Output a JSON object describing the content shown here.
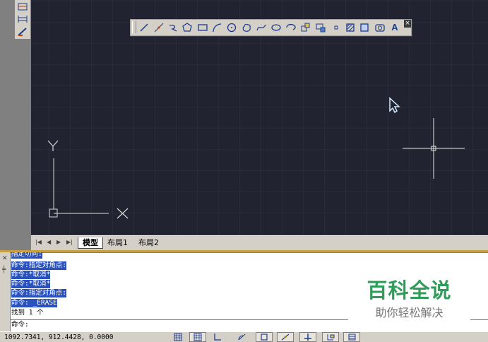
{
  "draw_toolbar": {
    "icons": [
      "line-icon",
      "construction-line-icon",
      "polyline-icon",
      "polygon-icon",
      "rectangle-icon",
      "arc-icon",
      "circle-icon",
      "revision-cloud-icon",
      "spline-icon",
      "ellipse-icon",
      "ellipse-arc-icon",
      "insert-block-icon",
      "make-block-icon",
      "point-icon",
      "hatch-icon",
      "gradient-icon",
      "region-icon",
      "multiline-text-icon"
    ],
    "text_glyph": "A",
    "close_glyph": "×"
  },
  "left_toolbar": {
    "icons": [
      "dimension-icon",
      "dimension-baseline-icon",
      "leader-icon"
    ]
  },
  "axis": {
    "y_label": "Y",
    "x_label": "X"
  },
  "layout_tabs": {
    "tabs": [
      {
        "label": "模型",
        "active": true
      },
      {
        "label": "布局1",
        "active": false
      },
      {
        "label": "布局2",
        "active": false
      }
    ]
  },
  "command_history": [
    {
      "text": "指定切向:",
      "highlighted": true
    },
    {
      "text": "命令:指定对角点:",
      "highlighted": true
    },
    {
      "text": "命令:*取消*",
      "highlighted": true
    },
    {
      "text": "命令:*取消*",
      "highlighted": true
    },
    {
      "text": "命令:指定对角点:",
      "highlighted": true
    },
    {
      "text": "命令: _ERASE",
      "highlighted": true
    },
    {
      "text": "找到 1 个",
      "highlighted": false
    }
  ],
  "command_prompt": "命令:",
  "watermark": {
    "title": "百科全说",
    "subtitle": "助你轻松解决"
  },
  "status_bar": {
    "coordinates": "1092.7341, 912.4428, 0.0000"
  },
  "colors": {
    "canvas_bg": "#212430",
    "grid_line": "#2e3344",
    "highlight": "#2a52be",
    "watermark_green": "#2f9c5a",
    "toolbar_icon": "#1a3c8c"
  }
}
